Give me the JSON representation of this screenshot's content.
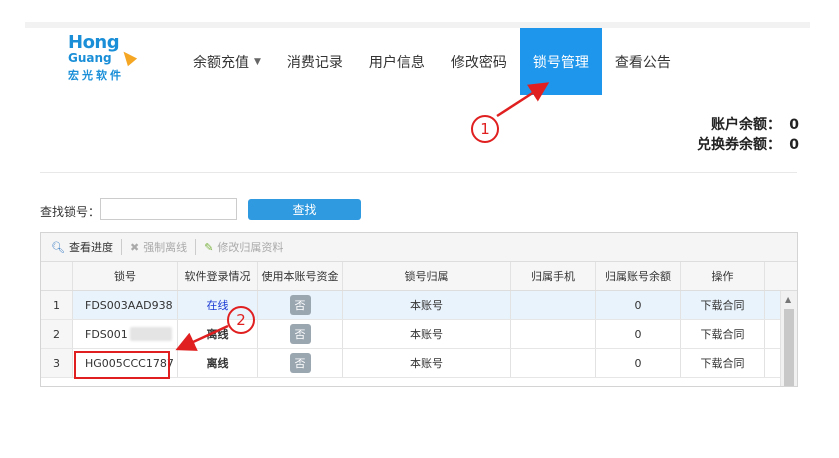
{
  "logo": {
    "line1": "Hong",
    "line2": "Guang",
    "line3": "宏光软件"
  },
  "nav": {
    "items": [
      {
        "label": "余额充值",
        "has_caret": true
      },
      {
        "label": "消费记录"
      },
      {
        "label": "用户信息"
      },
      {
        "label": "修改密码"
      },
      {
        "label": "锁号管理",
        "active": true
      },
      {
        "label": "查看公告"
      }
    ]
  },
  "balance": {
    "account_label": "账户余额：",
    "account_value": "0",
    "coupon_label": "兑换券余额：",
    "coupon_value": "0"
  },
  "search": {
    "label": "查找锁号：",
    "value": "",
    "button": "查找"
  },
  "toolbar": {
    "progress": "查看进度",
    "force_offline": "强制离线",
    "edit_owner": "修改归属资料"
  },
  "table": {
    "headers": [
      "",
      "锁号",
      "软件登录情况",
      "使用本账号资金",
      "锁号归属",
      "归属手机",
      "归属账号余额",
      "操作"
    ],
    "rows": [
      {
        "index": "1",
        "lock": "FDS003AAD938",
        "status": "在线",
        "use_funds": "否",
        "owner": "本账号",
        "phone": "",
        "balance": "0",
        "action": "下载合同"
      },
      {
        "index": "2",
        "lock": "FDS001",
        "status": "离线",
        "use_funds": "否",
        "owner": "本账号",
        "phone": "",
        "balance": "0",
        "action": "下载合同"
      },
      {
        "index": "3",
        "lock": "HG005CCC1787",
        "status": "离线",
        "use_funds": "否",
        "owner": "本账号",
        "phone": "",
        "balance": "0",
        "action": "下载合同"
      }
    ]
  },
  "annotations": {
    "marker1": "1",
    "marker2": "2"
  },
  "colors": {
    "accent": "#1e96eb",
    "annotation": "#e02020"
  }
}
